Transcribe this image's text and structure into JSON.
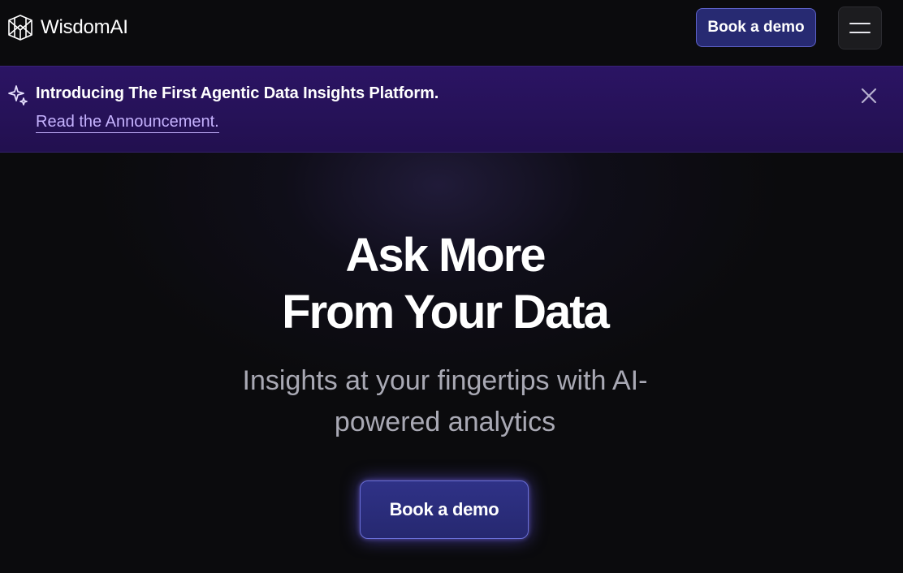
{
  "nav": {
    "brand_name": "WisdomAI",
    "brand_icon": "wisdomai-logo-icon",
    "demo_label": "Book a demo",
    "menu_icon": "hamburger-menu-icon"
  },
  "banner": {
    "icon": "sparkle-icon",
    "title": "Introducing The First Agentic Data Insights Platform.",
    "link_text": "Read the Announcement.",
    "close_icon": "close-icon"
  },
  "hero": {
    "title_line1": "Ask More",
    "title_line2": "From Your Data",
    "subtitle_line1": "Insights at your fingertips with AI-",
    "subtitle_line2": "powered analytics",
    "cta_label": "Book a demo"
  },
  "colors": {
    "background": "#0b0b0d",
    "banner": "#2b1464",
    "button": "#272a72",
    "link": "#c6b3ff"
  }
}
